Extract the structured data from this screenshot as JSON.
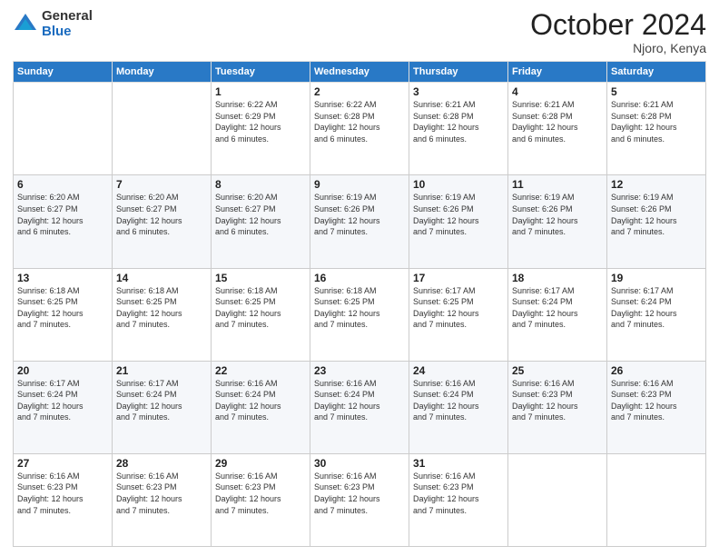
{
  "logo": {
    "general": "General",
    "blue": "Blue"
  },
  "header": {
    "month": "October 2024",
    "location": "Njoro, Kenya"
  },
  "weekdays": [
    "Sunday",
    "Monday",
    "Tuesday",
    "Wednesday",
    "Thursday",
    "Friday",
    "Saturday"
  ],
  "weeks": [
    [
      {
        "day": null,
        "info": null
      },
      {
        "day": null,
        "info": null
      },
      {
        "day": "1",
        "info": "Sunrise: 6:22 AM\nSunset: 6:29 PM\nDaylight: 12 hours\nand 6 minutes."
      },
      {
        "day": "2",
        "info": "Sunrise: 6:22 AM\nSunset: 6:28 PM\nDaylight: 12 hours\nand 6 minutes."
      },
      {
        "day": "3",
        "info": "Sunrise: 6:21 AM\nSunset: 6:28 PM\nDaylight: 12 hours\nand 6 minutes."
      },
      {
        "day": "4",
        "info": "Sunrise: 6:21 AM\nSunset: 6:28 PM\nDaylight: 12 hours\nand 6 minutes."
      },
      {
        "day": "5",
        "info": "Sunrise: 6:21 AM\nSunset: 6:28 PM\nDaylight: 12 hours\nand 6 minutes."
      }
    ],
    [
      {
        "day": "6",
        "info": "Sunrise: 6:20 AM\nSunset: 6:27 PM\nDaylight: 12 hours\nand 6 minutes."
      },
      {
        "day": "7",
        "info": "Sunrise: 6:20 AM\nSunset: 6:27 PM\nDaylight: 12 hours\nand 6 minutes."
      },
      {
        "day": "8",
        "info": "Sunrise: 6:20 AM\nSunset: 6:27 PM\nDaylight: 12 hours\nand 6 minutes."
      },
      {
        "day": "9",
        "info": "Sunrise: 6:19 AM\nSunset: 6:26 PM\nDaylight: 12 hours\nand 7 minutes."
      },
      {
        "day": "10",
        "info": "Sunrise: 6:19 AM\nSunset: 6:26 PM\nDaylight: 12 hours\nand 7 minutes."
      },
      {
        "day": "11",
        "info": "Sunrise: 6:19 AM\nSunset: 6:26 PM\nDaylight: 12 hours\nand 7 minutes."
      },
      {
        "day": "12",
        "info": "Sunrise: 6:19 AM\nSunset: 6:26 PM\nDaylight: 12 hours\nand 7 minutes."
      }
    ],
    [
      {
        "day": "13",
        "info": "Sunrise: 6:18 AM\nSunset: 6:25 PM\nDaylight: 12 hours\nand 7 minutes."
      },
      {
        "day": "14",
        "info": "Sunrise: 6:18 AM\nSunset: 6:25 PM\nDaylight: 12 hours\nand 7 minutes."
      },
      {
        "day": "15",
        "info": "Sunrise: 6:18 AM\nSunset: 6:25 PM\nDaylight: 12 hours\nand 7 minutes."
      },
      {
        "day": "16",
        "info": "Sunrise: 6:18 AM\nSunset: 6:25 PM\nDaylight: 12 hours\nand 7 minutes."
      },
      {
        "day": "17",
        "info": "Sunrise: 6:17 AM\nSunset: 6:25 PM\nDaylight: 12 hours\nand 7 minutes."
      },
      {
        "day": "18",
        "info": "Sunrise: 6:17 AM\nSunset: 6:24 PM\nDaylight: 12 hours\nand 7 minutes."
      },
      {
        "day": "19",
        "info": "Sunrise: 6:17 AM\nSunset: 6:24 PM\nDaylight: 12 hours\nand 7 minutes."
      }
    ],
    [
      {
        "day": "20",
        "info": "Sunrise: 6:17 AM\nSunset: 6:24 PM\nDaylight: 12 hours\nand 7 minutes."
      },
      {
        "day": "21",
        "info": "Sunrise: 6:17 AM\nSunset: 6:24 PM\nDaylight: 12 hours\nand 7 minutes."
      },
      {
        "day": "22",
        "info": "Sunrise: 6:16 AM\nSunset: 6:24 PM\nDaylight: 12 hours\nand 7 minutes."
      },
      {
        "day": "23",
        "info": "Sunrise: 6:16 AM\nSunset: 6:24 PM\nDaylight: 12 hours\nand 7 minutes."
      },
      {
        "day": "24",
        "info": "Sunrise: 6:16 AM\nSunset: 6:24 PM\nDaylight: 12 hours\nand 7 minutes."
      },
      {
        "day": "25",
        "info": "Sunrise: 6:16 AM\nSunset: 6:23 PM\nDaylight: 12 hours\nand 7 minutes."
      },
      {
        "day": "26",
        "info": "Sunrise: 6:16 AM\nSunset: 6:23 PM\nDaylight: 12 hours\nand 7 minutes."
      }
    ],
    [
      {
        "day": "27",
        "info": "Sunrise: 6:16 AM\nSunset: 6:23 PM\nDaylight: 12 hours\nand 7 minutes."
      },
      {
        "day": "28",
        "info": "Sunrise: 6:16 AM\nSunset: 6:23 PM\nDaylight: 12 hours\nand 7 minutes."
      },
      {
        "day": "29",
        "info": "Sunrise: 6:16 AM\nSunset: 6:23 PM\nDaylight: 12 hours\nand 7 minutes."
      },
      {
        "day": "30",
        "info": "Sunrise: 6:16 AM\nSunset: 6:23 PM\nDaylight: 12 hours\nand 7 minutes."
      },
      {
        "day": "31",
        "info": "Sunrise: 6:16 AM\nSunset: 6:23 PM\nDaylight: 12 hours\nand 7 minutes."
      },
      {
        "day": null,
        "info": null
      },
      {
        "day": null,
        "info": null
      }
    ]
  ]
}
